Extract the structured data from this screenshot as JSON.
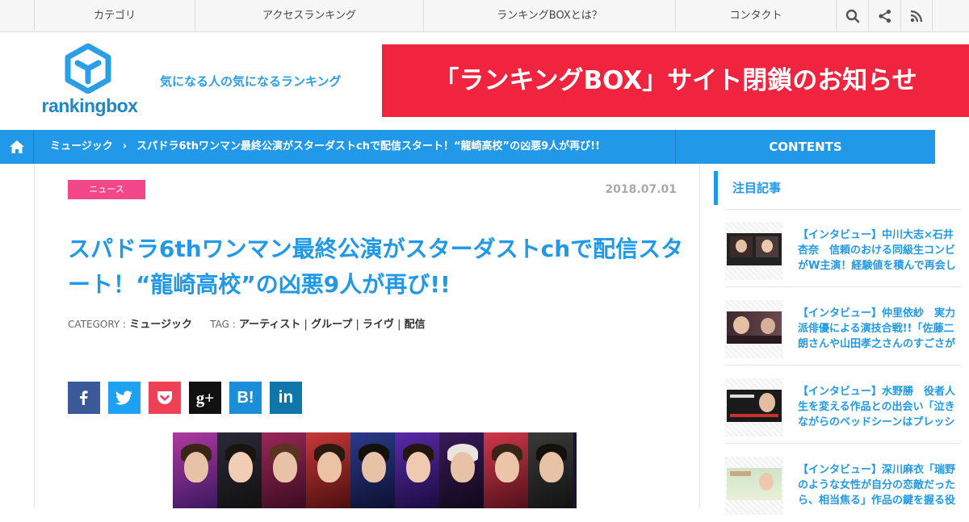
{
  "topnav": {
    "items": [
      "カテゴリ",
      "アクセスランキング",
      "ランキングBOXとは？",
      "コンタクト"
    ],
    "icons": [
      "search-icon",
      "share-icon",
      "rss-icon"
    ]
  },
  "header": {
    "logo_text": "rankingbox",
    "tagline": "気になる人の気になるランキング",
    "banner": "「ランキングBOX」サイト閉鎖のお知らせ"
  },
  "breadcrumb": {
    "category": "ミュージック",
    "current": "スパドラ6thワンマン最終公演がスターダストchで配信スタート！“龍崎高校”の凶悪9人が再び!!",
    "contents_label": "CONTENTS"
  },
  "article": {
    "badge": "ニュース",
    "date": "2018.07.01",
    "title": "スパドラ6thワンマン最終公演がスターダストchで配信スタート！“龍崎高校”の凶悪9人が再び!!",
    "category_label": "CATEGORY :",
    "category": "ミュージック",
    "tag_label": "TAG :",
    "tags": [
      "アーティスト",
      "グループ",
      "ライヴ",
      "配信"
    ],
    "tag_sep": "|",
    "share_buttons": [
      {
        "icon": "facebook-icon",
        "glyph": "f",
        "color": "#3b5998"
      },
      {
        "icon": "twitter-icon",
        "glyph": "t",
        "color": "#1da1f2"
      },
      {
        "icon": "pocket-icon",
        "glyph": "p",
        "color": "#ef4056"
      },
      {
        "icon": "google-plus-icon",
        "glyph": "g+",
        "color": "#111111"
      },
      {
        "icon": "hatena-bookmark-icon",
        "glyph": "B!",
        "color": "#1a8fd8"
      },
      {
        "icon": "linkedin-icon",
        "glyph": "in",
        "color": "#0e76a8"
      }
    ]
  },
  "sidebar": {
    "heading": "注目記事",
    "articles": [
      {
        "title": "【インタビュー】中川大志×石井杏奈　信頼のおける同級生コンビがW主演！経験値を積んで再会し"
      },
      {
        "title": "【インタビュー】仲里依紗　実力派俳優による演技合戦!!「佐藤二朗さんや山田孝之さんのすごさが"
      },
      {
        "title": "【インタビュー】水野勝　役者人生を変える作品との出会い「泣きながらのベッドシーンはプレッシ"
      },
      {
        "title": "【インタビュー】深川麻衣「瑞野のような女性が自分の恋敵だったら、相当焦る」作品の鍵を握る役"
      }
    ]
  },
  "colors": {
    "accent": "#2199e8",
    "banner": "#f0243e",
    "badge": "#f2478b"
  }
}
